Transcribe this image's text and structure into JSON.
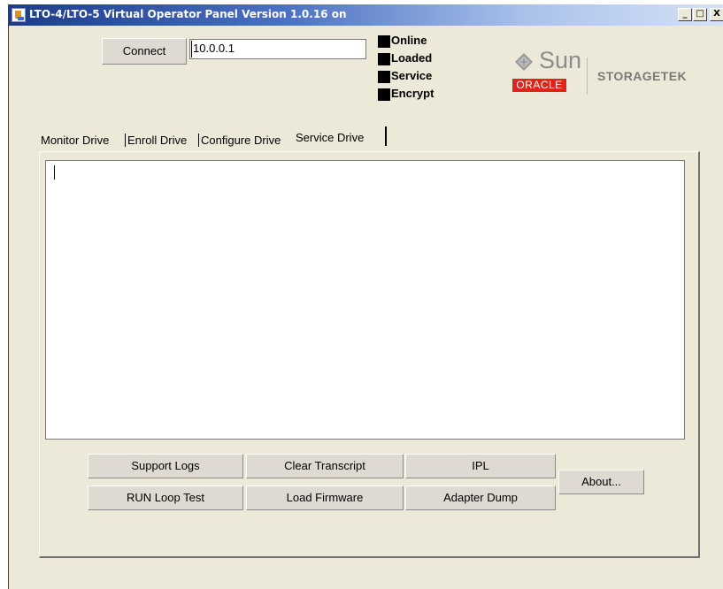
{
  "window": {
    "title": "LTO-4/LTO-5 Virtual Operator Panel Version 1.0.16 on",
    "minimize_label": "_",
    "maximize_label": "□",
    "close_label": "X"
  },
  "connection": {
    "connect_label": "Connect",
    "address_value": "10.0.0.1"
  },
  "status_indicators": [
    {
      "label": "Online",
      "color": "#000000"
    },
    {
      "label": "Loaded",
      "color": "#000000"
    },
    {
      "label": "Service",
      "color": "#000000"
    },
    {
      "label": "Encrypt",
      "color": "#000000"
    }
  ],
  "logo": {
    "sun_text": "Sun",
    "oracle_text": "ORACLE",
    "storagetek_text": "STORAGETEK",
    "oracle_color": "#e2231a"
  },
  "tabs": [
    {
      "label": "Monitor Drive",
      "active": false
    },
    {
      "label": "Enroll Drive",
      "active": false
    },
    {
      "label": "Configure Drive",
      "active": false
    },
    {
      "label": "Service Drive",
      "active": true
    }
  ],
  "transcript": {
    "value": ""
  },
  "actions": {
    "support_logs": "Support Logs",
    "clear_transcript": "Clear Transcript",
    "ipl": "IPL",
    "run_loop_test": "RUN Loop Test",
    "load_firmware": "Load Firmware",
    "adapter_dump": "Adapter Dump",
    "about": "About..."
  }
}
